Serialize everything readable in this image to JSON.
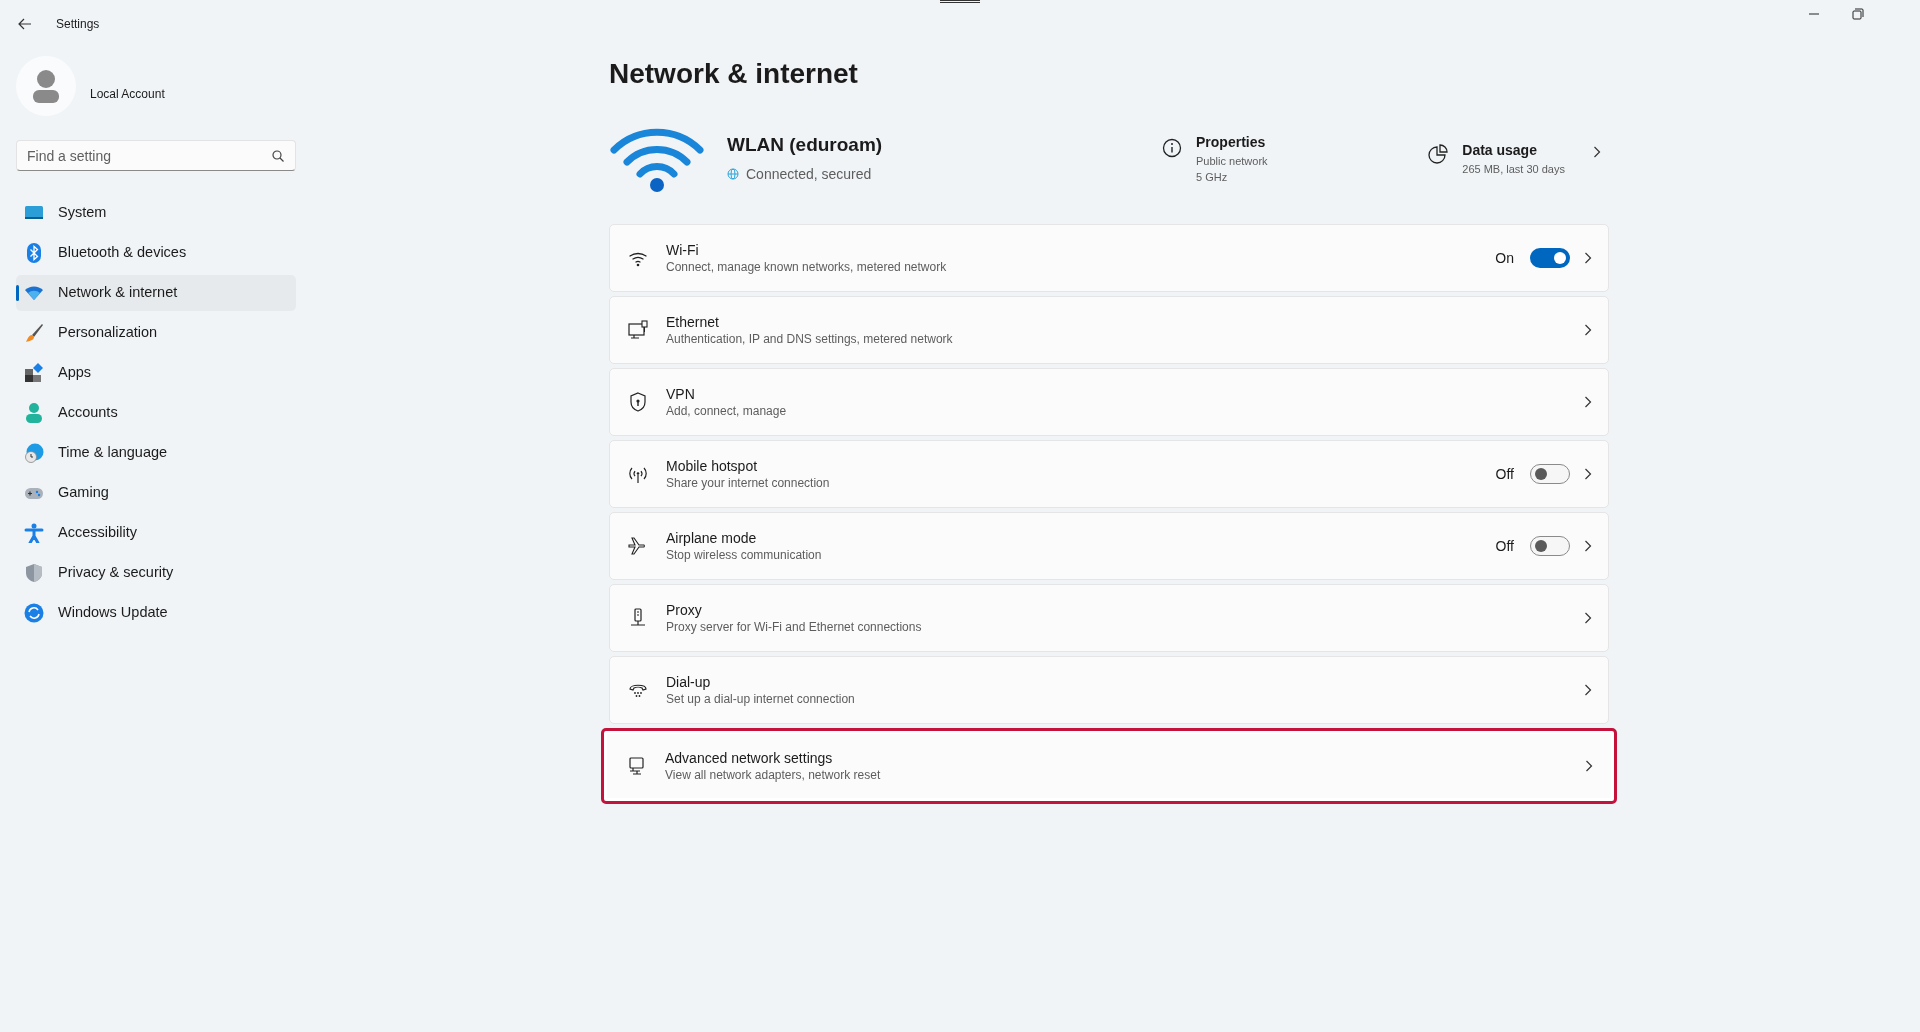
{
  "window": {
    "title": "Settings"
  },
  "account": {
    "name": "Local Account"
  },
  "search": {
    "placeholder": "Find a setting"
  },
  "sidebar": {
    "items": [
      {
        "label": "System",
        "selected": false
      },
      {
        "label": "Bluetooth & devices",
        "selected": false
      },
      {
        "label": "Network & internet",
        "selected": true
      },
      {
        "label": "Personalization",
        "selected": false
      },
      {
        "label": "Apps",
        "selected": false
      },
      {
        "label": "Accounts",
        "selected": false
      },
      {
        "label": "Time & language",
        "selected": false
      },
      {
        "label": "Gaming",
        "selected": false
      },
      {
        "label": "Accessibility",
        "selected": false
      },
      {
        "label": "Privacy & security",
        "selected": false
      },
      {
        "label": "Windows Update",
        "selected": false
      }
    ]
  },
  "page": {
    "title": "Network & internet"
  },
  "connection": {
    "name": "WLAN (eduroam)",
    "status": "Connected, secured",
    "properties": {
      "title": "Properties",
      "lines": [
        "Public network",
        "5 GHz"
      ]
    },
    "data_usage": {
      "title": "Data usage",
      "detail": "265 MB, last 30 days"
    }
  },
  "settings": [
    {
      "kind": "toggle",
      "title": "Wi-Fi",
      "subtitle": "Connect, manage known networks, metered network",
      "state_label": "On",
      "on": true,
      "highlighted": false
    },
    {
      "kind": "link",
      "title": "Ethernet",
      "subtitle": "Authentication, IP and DNS settings, metered network",
      "highlighted": false
    },
    {
      "kind": "link",
      "title": "VPN",
      "subtitle": "Add, connect, manage",
      "highlighted": false
    },
    {
      "kind": "toggle",
      "title": "Mobile hotspot",
      "subtitle": "Share your internet connection",
      "state_label": "Off",
      "on": false,
      "highlighted": false
    },
    {
      "kind": "toggle",
      "title": "Airplane mode",
      "subtitle": "Stop wireless communication",
      "state_label": "Off",
      "on": false,
      "highlighted": false
    },
    {
      "kind": "link",
      "title": "Proxy",
      "subtitle": "Proxy server for Wi-Fi and Ethernet connections",
      "highlighted": false
    },
    {
      "kind": "link",
      "title": "Dial-up",
      "subtitle": "Set up a dial-up internet connection",
      "highlighted": false
    },
    {
      "kind": "link",
      "title": "Advanced network settings",
      "subtitle": "View all network adapters, network reset",
      "highlighted": true
    }
  ]
}
